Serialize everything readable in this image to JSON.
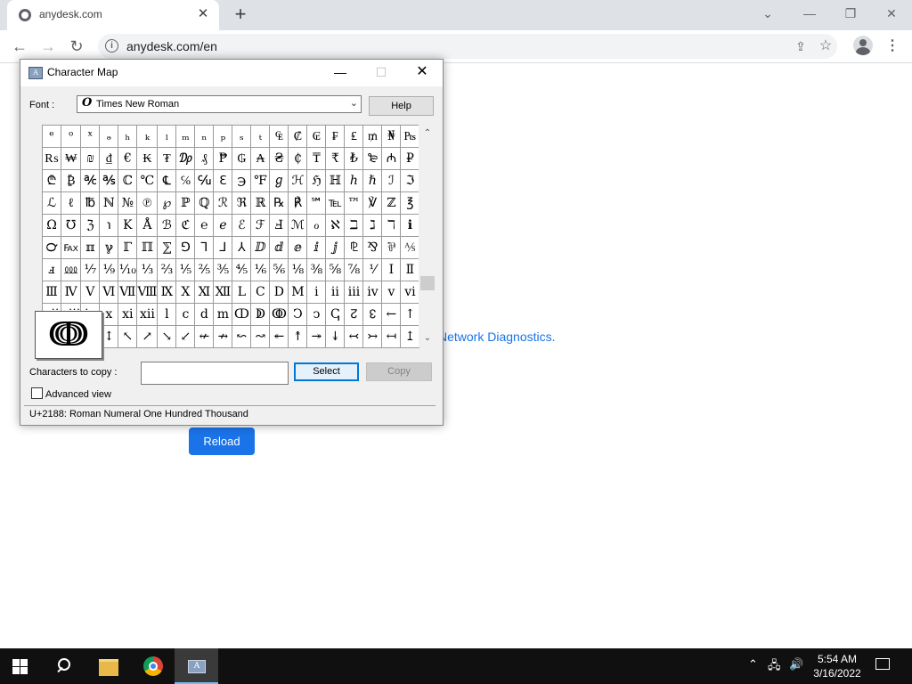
{
  "browser": {
    "tab_title": "anydesk.com",
    "tab_close": "✕",
    "new_tab": "+",
    "window_controls": [
      "⌄",
      "—",
      "❐",
      "✕"
    ],
    "nav": {
      "back": "←",
      "forward": "→",
      "reload": "↻"
    },
    "url": "anydesk.com/en",
    "menu": "⋮"
  },
  "page": {
    "link_text": "Network Diagnostics.",
    "reload_button": "Reload"
  },
  "charmap": {
    "title": "Character Map",
    "controls": {
      "minimize": "—",
      "maximize": "☐",
      "close": "✕"
    },
    "font_label": "Font :",
    "font_icon": "O",
    "font_value": "Times New Roman",
    "help_button": "Help",
    "grid": [
      [
        "ᵉ",
        "ᵒ",
        "ˣ",
        "ₔ",
        "ₕ",
        "ₖ",
        "ₗ",
        "ₘ",
        "ₙ",
        "ₚ",
        "ₛ",
        "ₜ",
        "₠",
        "₡",
        "₢",
        "₣",
        "₤",
        "₥",
        "₦",
        "₧"
      ],
      [
        "₨",
        "₩",
        "₪",
        "₫",
        "€",
        "₭",
        "₮",
        "₯",
        "₰",
        "₱",
        "₲",
        "₳",
        "₴",
        "₵",
        "₸",
        "₹",
        "₺",
        "₻",
        "₼",
        "₽"
      ],
      [
        "₾",
        "₿",
        "℀",
        "℁",
        "ℂ",
        "℃",
        "℄",
        "℅",
        "℆",
        "ℇ",
        "℈",
        "℉",
        "ℊ",
        "ℋ",
        "ℌ",
        "ℍ",
        "ℎ",
        "ℏ",
        "ℐ",
        "ℑ"
      ],
      [
        "ℒ",
        "ℓ",
        "℔",
        "ℕ",
        "№",
        "℗",
        "℘",
        "ℙ",
        "ℚ",
        "ℛ",
        "ℜ",
        "ℝ",
        "℞",
        "℟",
        "℠",
        "℡",
        "™",
        "℣",
        "ℤ",
        "℥"
      ],
      [
        "Ω",
        "℧",
        "ℨ",
        "℩",
        "K",
        "Å",
        "ℬ",
        "ℭ",
        "℮",
        "ℯ",
        "ℰ",
        "ℱ",
        "Ⅎ",
        "ℳ",
        "ℴ",
        "ℵ",
        "ℶ",
        "ℷ",
        "ℸ",
        "ℹ"
      ],
      [
        "℺",
        "℻",
        "ℼ",
        "ℽ",
        "ℾ",
        "ℿ",
        "⅀",
        "⅁",
        "⅂",
        "⅃",
        "⅄",
        "ⅅ",
        "ⅆ",
        "ⅇ",
        "ⅈ",
        "ⅉ",
        "⅊",
        "⅋",
        "⅌",
        "⅍"
      ],
      [
        "ⅎ",
        "⅏",
        "⅐",
        "⅑",
        "⅒",
        "⅓",
        "⅔",
        "⅕",
        "⅖",
        "⅗",
        "⅘",
        "⅙",
        "⅚",
        "⅛",
        "⅜",
        "⅝",
        "⅞",
        "⅟",
        "Ⅰ",
        "Ⅱ"
      ],
      [
        "Ⅲ",
        "Ⅳ",
        "Ⅴ",
        "Ⅵ",
        "Ⅶ",
        "Ⅷ",
        "Ⅸ",
        "Ⅹ",
        "Ⅺ",
        "Ⅻ",
        "Ⅼ",
        "Ⅽ",
        "Ⅾ",
        "Ⅿ",
        "ⅰ",
        "ⅱ",
        "ⅲ",
        "ⅳ",
        "ⅴ",
        "ⅵ"
      ],
      [
        "ⅶ",
        "ⅷ",
        "ⅸ",
        "ⅹ",
        "ⅺ",
        "ⅻ",
        "ⅼ",
        "ⅽ",
        "ⅾ",
        "ⅿ",
        "ↀ",
        "ↁ",
        "ↂ",
        "Ↄ",
        "ↄ",
        "ↅ",
        "↊",
        "↋",
        "←",
        "↑"
      ],
      [
        "→",
        "↓",
        "↔",
        "↕",
        "↖",
        "↗",
        "↘",
        "↙",
        "↚",
        "↛",
        "↜",
        "↝",
        "↞",
        "↟",
        "↠",
        "↡",
        "↢",
        "↣",
        "↤",
        "↥"
      ]
    ],
    "grid_visible": [
      [
        "ᵉ",
        "ᵒ",
        "ˣ",
        "ₔ",
        "ₕ",
        "ₖ",
        "ₗ",
        "ₘ",
        "ₙ",
        "ₚ",
        "ₛ",
        "ₜ",
        "₠",
        "₡",
        "₢",
        "₣",
        "₤",
        "₥",
        "₦",
        "₧"
      ],
      [
        "₨",
        "₩",
        "₪",
        "₫",
        "€",
        "₭",
        "₮",
        "₯",
        "₰",
        "₱",
        "₲",
        "₳",
        "₴",
        "₵",
        "₸",
        "₹",
        "₺",
        "₻",
        "₼",
        "₽"
      ],
      [
        "₾",
        "₿",
        "℀",
        "℁",
        "ℂ",
        "℃",
        "℄",
        "℅",
        "℆",
        "ℇ",
        "℈",
        "℉",
        "ℊ",
        "ℋ",
        "ℌ",
        "ℍ",
        "ℎ",
        "ℏ",
        "ℐ",
        "ℑ"
      ],
      [
        "ℒ",
        "ℓ",
        "℔",
        "ℕ",
        "№",
        "℗",
        "℘",
        "ℙ",
        "ℚ",
        "ℛ",
        "ℜ",
        "ℝ",
        "℞",
        "℟",
        "℠",
        "℡",
        "™",
        "℣",
        "ℤ",
        "℥"
      ],
      [
        "Ω",
        "℧",
        "ℨ",
        "℩",
        "K",
        "Å",
        "ℬ",
        "ℭ",
        "℮",
        "ℯ",
        "ℰ",
        "ℱ",
        "Ⅎ",
        "ℳ",
        "ℴ",
        "ℵ",
        "ℶ",
        "ℷ",
        "ℸ",
        "ℹ"
      ],
      [
        "℺",
        "℻",
        "ℼ",
        "ℽ",
        "ℾ",
        "ℿ",
        "⅀",
        "⅁",
        "⅂",
        "⅃",
        "⅄",
        "ⅅ",
        "ⅆ",
        "ⅇ",
        "ⅈ",
        "ⅉ",
        "⅊",
        "⅋",
        "⅌",
        "⅍"
      ],
      [
        "ⅎ",
        "⅏",
        "⅐",
        "⅑",
        "⅒",
        "⅓",
        "⅔",
        "⅕",
        "⅖",
        "⅗",
        "⅘",
        "⅙",
        "⅚",
        "⅛",
        "⅜",
        "⅝",
        "⅞",
        "⅟",
        "Ⅰ",
        "Ⅱ"
      ],
      [
        "Ⅲ",
        "Ⅳ",
        "Ⅴ",
        "Ⅵ",
        "Ⅶ",
        "Ⅷ",
        "Ⅸ",
        "Ⅹ",
        "Ⅺ",
        "Ⅻ",
        "Ⅼ",
        "Ⅽ",
        "Ⅾ",
        "Ⅿ",
        "ⅰ",
        "ⅱ",
        "ⅲ",
        "ⅳ",
        "ⅴ",
        "ⅵ"
      ],
      [
        "ⅶ",
        "ⅷ",
        "ⅸ",
        "ⅹ",
        "ⅺ",
        "ⅻ",
        "ⅼ",
        "ⅽ",
        "ⅾ",
        "ⅿ",
        "ↀ",
        "ↁ",
        "ↂ",
        "Ↄ",
        "ↄ",
        "ↅ",
        "↊",
        "↋",
        "←",
        "↑"
      ],
      [
        "→",
        "↓",
        "↔",
        "↕",
        "↖",
        "↗",
        "↘",
        "↙",
        "↚",
        "↛",
        "↜",
        "↝",
        "↞",
        "↟",
        "↠",
        "↡",
        "↢",
        "↣",
        "↤",
        "↥"
      ]
    ],
    "zoom_char": "ↈ",
    "scroll_up": "⌃",
    "scroll_down": "⌄",
    "copy_label": "Characters to copy :",
    "copy_value": "",
    "select_button": "Select",
    "copy_button": "Copy",
    "advanced_view_label": "Advanced view",
    "status_text": "U+2188: Roman Numeral One Hundred Thousand"
  },
  "taskbar": {
    "tray_chevron": "⌃",
    "tray_network": "🖧",
    "tray_volume": "🔊",
    "time": "5:54 AM",
    "date": "3/16/2022"
  }
}
